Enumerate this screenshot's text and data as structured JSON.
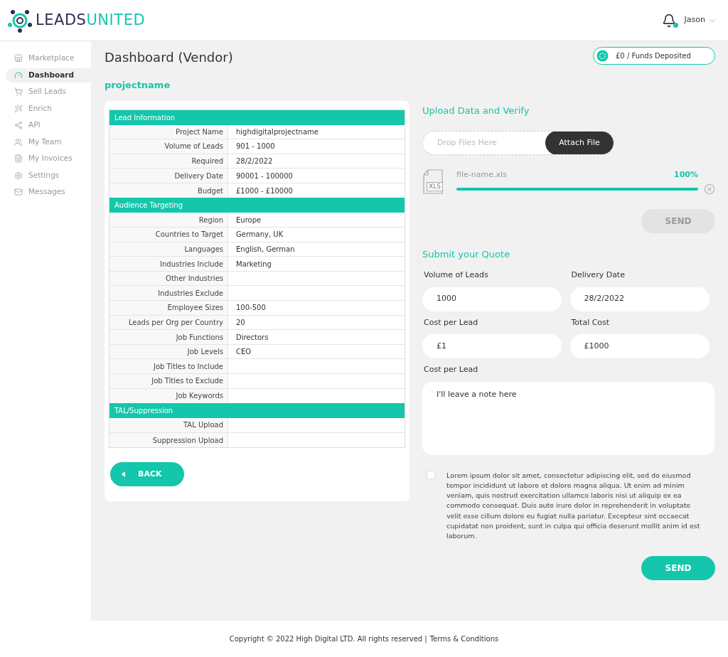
{
  "logo": {
    "first": "LEADS",
    "second": "UNITED"
  },
  "header": {
    "notification": true,
    "user": "Jason"
  },
  "sidebar": {
    "items": [
      {
        "label": "Marketplace",
        "kind": "store",
        "selected": false
      },
      {
        "label": "Dashboard",
        "kind": "gauge",
        "selected": true
      },
      {
        "label": "Sell Leads",
        "kind": "cart",
        "selected": false
      },
      {
        "label": "Enrich",
        "kind": "wand",
        "selected": false
      },
      {
        "label": "API",
        "kind": "share",
        "selected": false
      },
      {
        "label": "My Team",
        "kind": "team",
        "selected": false
      },
      {
        "label": "My Invoices",
        "kind": "invoice",
        "selected": false
      },
      {
        "label": "Settings",
        "kind": "gear",
        "selected": false
      },
      {
        "label": "Messages",
        "kind": "mail",
        "selected": false
      }
    ]
  },
  "page_title": "Dashboard (Vendor)",
  "funds": "£0 / Funds Deposited",
  "project_name": "projectname",
  "table": {
    "sections": [
      {
        "title": "Lead Information",
        "rows": [
          {
            "label": "Project Name",
            "value": "highdigitalprojectname"
          },
          {
            "label": "Volume of Leads",
            "value": "901 - 1000"
          },
          {
            "label": "Required",
            "value": "28/2/2022"
          },
          {
            "label": "Delivery Date",
            "value": "90001 - 100000"
          },
          {
            "label": "Budget",
            "value": "£1000 - £10000"
          }
        ]
      },
      {
        "title": "Audience Targeting",
        "rows": [
          {
            "label": "Region",
            "value": "Europe"
          },
          {
            "label": "Countries to Target",
            "value": "Germany, UK"
          },
          {
            "label": "Languages",
            "value": "English, German"
          },
          {
            "label": "Industries Include",
            "value": "Marketing"
          },
          {
            "label": "Other Industries"
          },
          {
            "label": "Industries Exclude"
          },
          {
            "label": "Employee Sizes",
            "value": "100-500"
          },
          {
            "label": "Leads per Org per Country",
            "value": "20"
          },
          {
            "label": "Job Functions",
            "value": "Directors"
          },
          {
            "label": "Job Levels",
            "value": "CEO"
          },
          {
            "label": "Job Titles to Include"
          },
          {
            "label": "Job Titles to Exclude"
          },
          {
            "label": "Job Keywords"
          }
        ]
      },
      {
        "title": "TAL/Suppression",
        "rows": [
          {
            "label": "TAL Upload"
          },
          {
            "label": "Suppression Upload"
          }
        ]
      }
    ]
  },
  "back_button": "BACK",
  "upload": {
    "title": "Upload Data and Verify",
    "placeholder": "Drop Files Here",
    "attach_button": "Attach File",
    "file": {
      "type_label": "XLS",
      "name": "file-name.xls",
      "percent": "100%",
      "level": 1
    },
    "send_button": {
      "label": "SEND",
      "disabled": true
    }
  },
  "quote": {
    "title": "Submit your Quote",
    "fields": [
      {
        "label": "Volume of Leads",
        "value": "1000",
        "kind": "input"
      },
      {
        "label": "Delivery Date",
        "value": "28/2/2022",
        "kind": "input"
      },
      {
        "label": "Cost per Lead",
        "value": "£1",
        "kind": "input"
      },
      {
        "label": "Total Cost",
        "value": "£1000",
        "kind": "input"
      },
      {
        "label": "Cost per Lead",
        "value": "I'll leave a note here",
        "kind": "textarea"
      }
    ],
    "terms": {
      "checked": false,
      "text": "Lorem ipsum dolor sit amet, consectetur adipiscing elit, sed do eiusmod tempor incididunt ut labore et dolore magna aliqua. Ut enim ad minim veniam, quis nostrud exercitation ullamco laboris nisi ut aliquip ex ea commodo consequat. Duis aute irure dolor in reprehenderit in voluptate velit esse cillum dolore eu fugiat nulla pariatur. Excepteur sint occaecat cupidatat non proident, sunt in culpa qui officia deserunt mollit anim id est laborum."
    },
    "send_button": {
      "label": "SEND",
      "disabled": false
    }
  },
  "footer": {
    "copyright": "Copyright © 2022 High Digital LTD. All rights reserved |",
    "link": "Terms & Conditions"
  }
}
